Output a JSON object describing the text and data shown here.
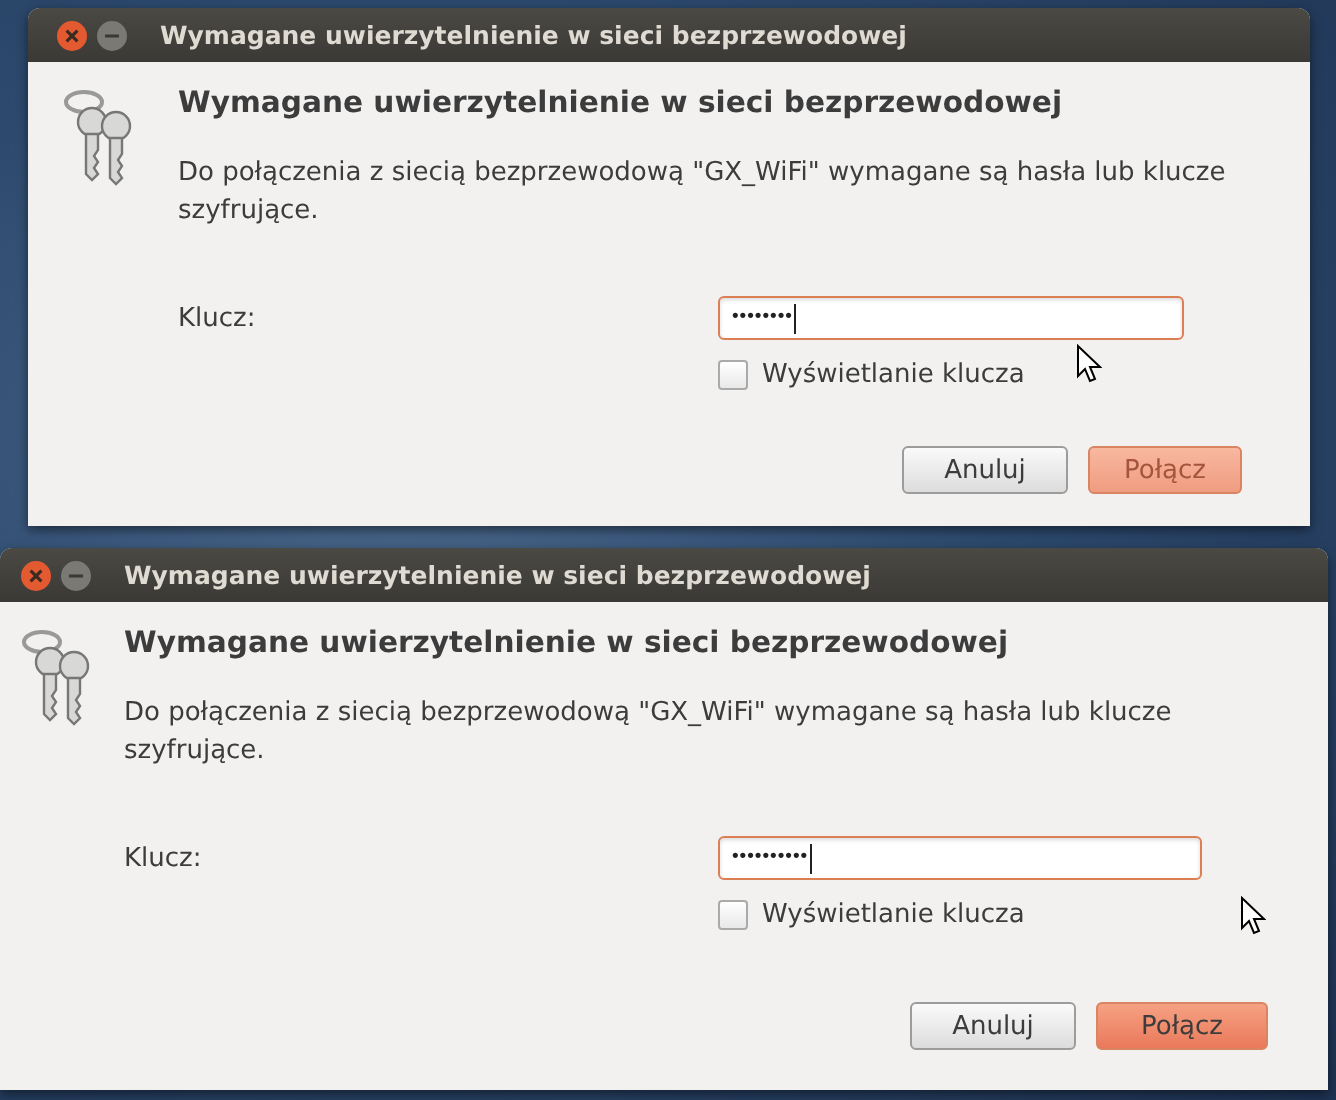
{
  "dialogs": [
    {
      "title": "Wymagane uwierzytelnienie w sieci bezprzewodowej",
      "heading": "Wymagane uwierzytelnienie w sieci bezprzewodowej",
      "message": "Do połączenia z siecią bezprzewodową \"GX_WiFi\" wymagane są hasła lub klucze szyfrujące.",
      "key_label": "Klucz:",
      "key_value": "••••••••",
      "show_key": {
        "label": "Wyświetlanie klucza",
        "checked": false
      },
      "buttons": [
        {
          "label": "Anuluj",
          "kind": "cancel",
          "disabled": false
        },
        {
          "label": "Połącz",
          "kind": "connect",
          "disabled": true
        }
      ]
    },
    {
      "title": "Wymagane uwierzytelnienie w sieci bezprzewodowej",
      "heading": "Wymagane uwierzytelnienie w sieci bezprzewodowej",
      "message": "Do połączenia z siecią bezprzewodową \"GX_WiFi\" wymagane są hasła lub klucze szyfrujące.",
      "key_label": "Klucz:",
      "key_value": "••••••••••",
      "show_key": {
        "label": "Wyświetlanie klucza",
        "checked": false
      },
      "buttons": [
        {
          "label": "Anuluj",
          "kind": "cancel",
          "disabled": false
        },
        {
          "label": "Połącz",
          "kind": "connect",
          "disabled": false
        }
      ]
    }
  ]
}
